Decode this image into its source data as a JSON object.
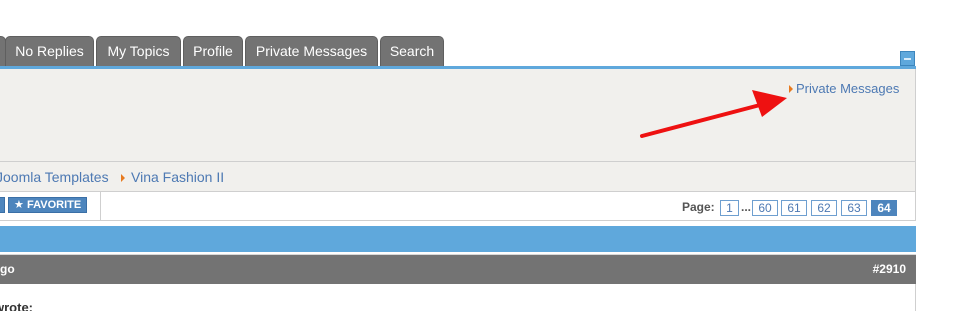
{
  "tabs": [
    {
      "label": ""
    },
    {
      "label": "No Replies"
    },
    {
      "label": "My Topics"
    },
    {
      "label": "Profile"
    },
    {
      "label": "Private Messages"
    },
    {
      "label": "Search"
    }
  ],
  "profile_box": {
    "private_messages_link": "Private Messages"
  },
  "breadcrumb": [
    {
      "label": "Joomla Templates"
    },
    {
      "label": "Vina Fashion II"
    }
  ],
  "actions": {
    "favorite_label": "FAVORITE"
  },
  "pagination": {
    "label": "Page:",
    "pages": [
      "1",
      "60",
      "61",
      "62",
      "63",
      "64"
    ],
    "ellipsis": "...",
    "current": "64"
  },
  "post": {
    "time_ago": "go",
    "number": "#2910",
    "quote_label": "wrote:"
  },
  "annotation": {
    "arrow_color": "#ee1111"
  },
  "colors": {
    "tab_bg": "#737373",
    "accent_blue": "#5fa8dc",
    "link": "#4d79b3",
    "bullet": "#e77a1f"
  }
}
